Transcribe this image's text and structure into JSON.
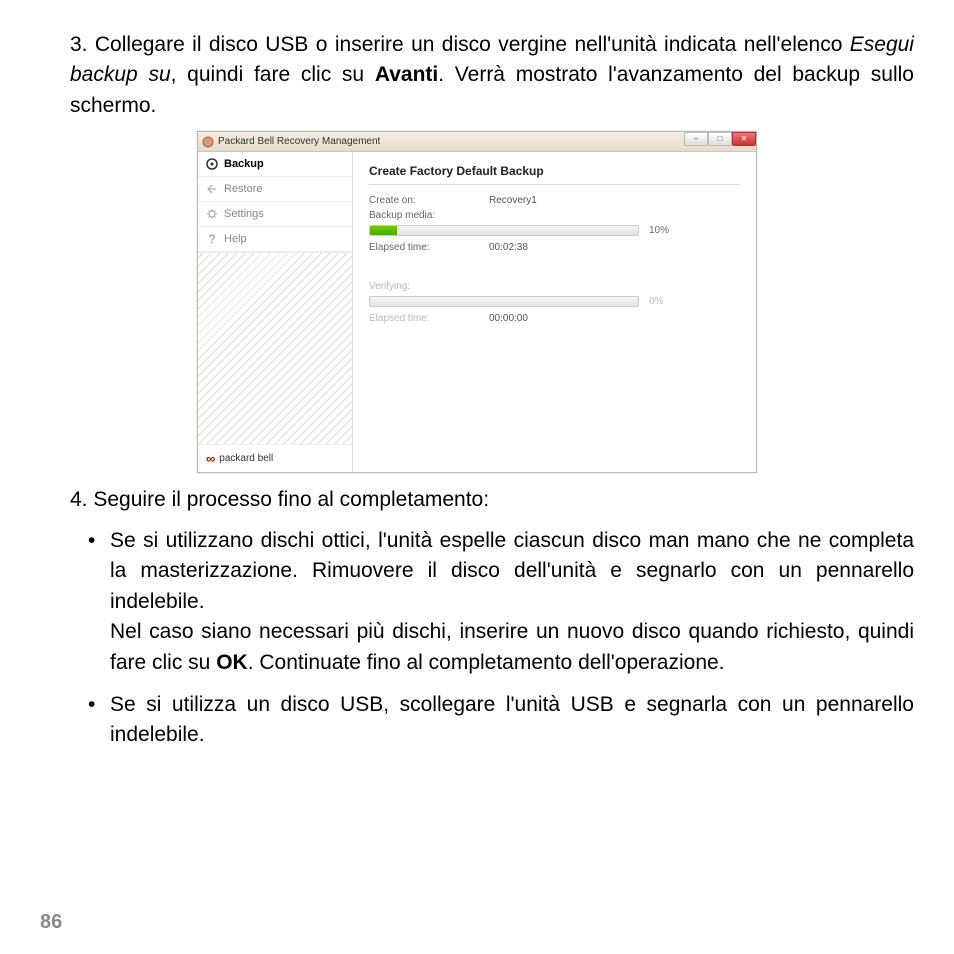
{
  "step3": {
    "number": "3.",
    "text_before_italic": "Collegare il disco USB o inserire un disco vergine nell'unità indicata nell'elenco ",
    "italic": "Esegui backup su",
    "text_mid": ", quindi fare clic su ",
    "bold": "Avanti",
    "text_after": ". Verrà mostrato l'avanzamento del backup sullo schermo."
  },
  "window": {
    "title": "Packard Bell Recovery Management",
    "sidebar": {
      "items": [
        {
          "label": "Backup",
          "active": true
        },
        {
          "label": "Restore",
          "active": false
        },
        {
          "label": "Settings",
          "active": false
        },
        {
          "label": "Help",
          "active": false
        }
      ]
    },
    "brand": "packard bell",
    "content": {
      "heading": "Create Factory Default Backup",
      "create_on_label": "Create on:",
      "create_on_value": "Recovery1",
      "backup_media_label": "Backup media:",
      "progress1_pct": "10%",
      "progress1_fill": "10%",
      "elapsed1_label": "Elapsed time:",
      "elapsed1_value": "00:02:38",
      "verifying_label": "Verifying:",
      "progress2_pct": "0%",
      "progress2_fill": "0%",
      "elapsed2_label": "Elapsed time:",
      "elapsed2_value": "00:00:00"
    }
  },
  "step4": {
    "number": "4.",
    "text": "Seguire il processo fino al completamento:"
  },
  "bullets": {
    "b1_part1": "Se si utilizzano dischi ottici, l'unità espelle ciascun disco man mano che ne completa la masterizzazione. Rimuovere il disco dell'unità e segnarlo con un pennarello indelebile.",
    "b1_part2_before": "Nel caso siano necessari più dischi, inserire un nuovo disco quando richiesto, quindi fare clic su ",
    "b1_bold": "OK",
    "b1_part2_after": ". Continuate fino al completamento dell'operazione.",
    "b2": "Se si utilizza un disco USB, scollegare l'unità USB e segnarla con un pennarello indelebile."
  },
  "page_number": "86"
}
